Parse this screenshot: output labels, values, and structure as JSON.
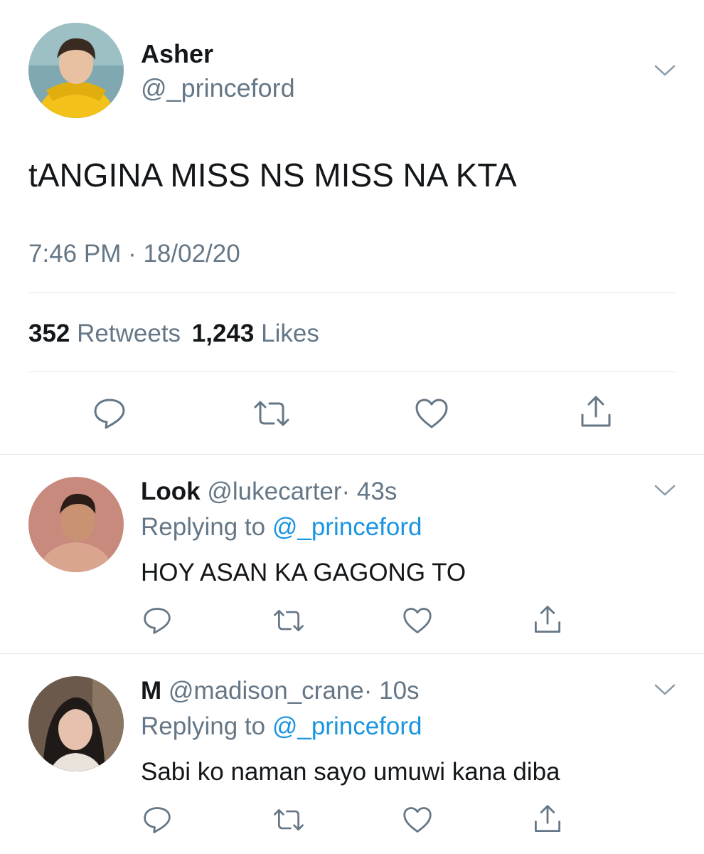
{
  "main_tweet": {
    "display_name": "Asher",
    "handle": "@_princeford",
    "text": "tANGINA MISS NS MISS NA KTA",
    "timestamp": "7:46 PM · 18/02/20",
    "retweets_count": "352",
    "retweets_label": "Retweets",
    "likes_count": "1,243",
    "likes_label": "Likes"
  },
  "replies": [
    {
      "display_name": "Look",
      "handle": "@lukecarter",
      "time": "· 43s",
      "replying_prefix": "Replying to",
      "replying_to": "@_princeford",
      "text": "HOY ASAN KA GAGONG TO"
    },
    {
      "display_name": "M",
      "handle": "@madison_crane",
      "time": "· 10s",
      "replying_prefix": "Replying to",
      "replying_to": "@_princeford",
      "text": "Sabi ko naman sayo umuwi kana diba"
    }
  ],
  "colors": {
    "accent": "#1b95e0",
    "secondary": "#657786",
    "divider": "#e1e8ed"
  },
  "icons": [
    "reply-icon",
    "retweet-icon",
    "like-icon",
    "share-icon",
    "chevron-down-icon"
  ]
}
